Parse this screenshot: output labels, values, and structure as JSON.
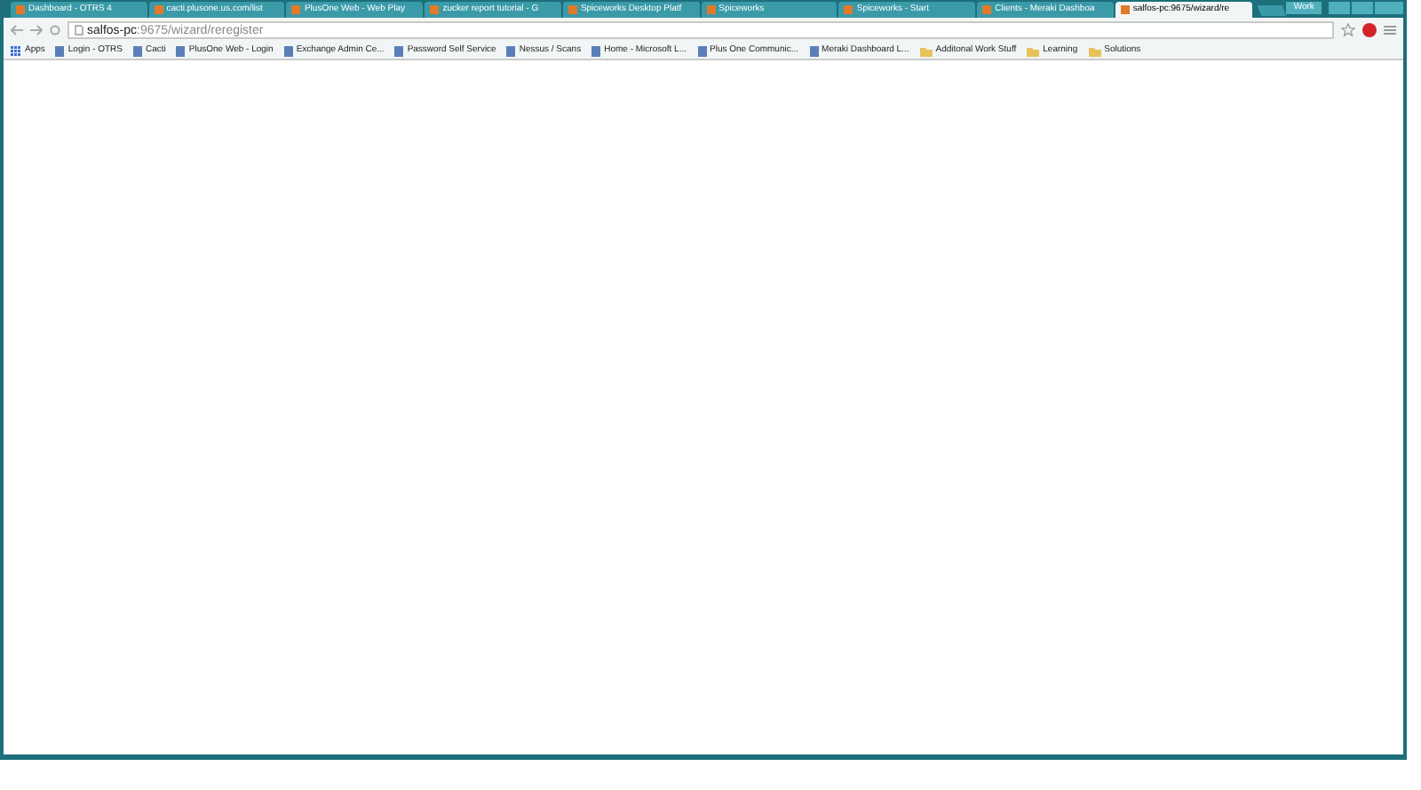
{
  "tabs": [
    {
      "label": "Dashboard - OTRS 4",
      "selected": false
    },
    {
      "label": "cacti.plusone.us.com/list",
      "selected": false
    },
    {
      "label": "PlusOne Web - Web Play",
      "selected": false
    },
    {
      "label": "zucker report tutorial - G",
      "selected": false
    },
    {
      "label": "Spiceworks Desktop Platf",
      "selected": false
    },
    {
      "label": "Spiceworks",
      "selected": false
    },
    {
      "label": "Spiceworks - Start",
      "selected": false
    },
    {
      "label": "Clients - Meraki Dashboa",
      "selected": false
    },
    {
      "label": "salfos-pc:9675/wizard/re",
      "selected": true
    }
  ],
  "window": {
    "profile": "Work"
  },
  "address_bar": {
    "host": "salfos-pc",
    "path": ":9675/wizard/reregister"
  },
  "bookmarks": [
    {
      "label": "Apps",
      "kind": "apps"
    },
    {
      "label": "Login - OTRS",
      "kind": "link"
    },
    {
      "label": "Cacti",
      "kind": "link"
    },
    {
      "label": "PlusOne Web - Login",
      "kind": "link"
    },
    {
      "label": "Exchange Admin Ce...",
      "kind": "link"
    },
    {
      "label": "Password Self Service",
      "kind": "link"
    },
    {
      "label": "Nessus / Scans",
      "kind": "link"
    },
    {
      "label": "Home - Microsoft L...",
      "kind": "link"
    },
    {
      "label": "Plus One Communic...",
      "kind": "link"
    },
    {
      "label": "Meraki Dashboard L...",
      "kind": "link"
    },
    {
      "label": "Additonal Work Stuff",
      "kind": "folder"
    },
    {
      "label": "Learning",
      "kind": "folder"
    },
    {
      "label": "Solutions",
      "kind": "folder"
    }
  ]
}
